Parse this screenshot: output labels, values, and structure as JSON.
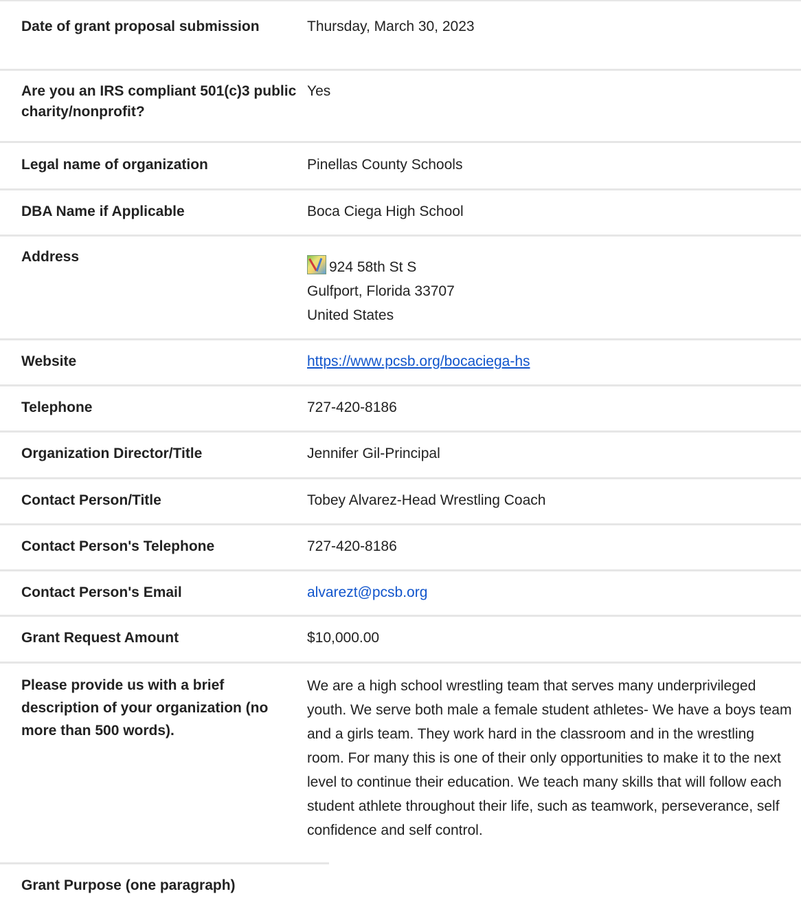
{
  "rows": [
    {
      "label": "Date of grant proposal submission",
      "value": "Thursday, March 30, 2023"
    },
    {
      "label": "Are you an IRS compliant 501(c)3 public charity/nonprofit?",
      "value": "Yes"
    },
    {
      "label": "Legal name of organization",
      "value": "Pinellas County Schools"
    },
    {
      "label": "DBA Name if Applicable",
      "value": "Boca Ciega High School"
    },
    {
      "label": "Address",
      "value": [
        "924 58th St S",
        "Gulfport, Florida 33707",
        "United States"
      ],
      "icon": "map-icon"
    },
    {
      "label": "Website",
      "value": "https://www.pcsb.org/bocaciega-hs"
    },
    {
      "label": "Telephone",
      "value": "727-420-8186"
    },
    {
      "label": "Organization Director/Title",
      "value": "Jennifer Gil-Principal"
    },
    {
      "label": "Contact Person/Title",
      "value": "Tobey Alvarez-Head Wrestling Coach"
    },
    {
      "label": "Contact Person's Telephone",
      "value": "727-420-8186"
    },
    {
      "label": "Contact Person's Email",
      "value": "alvarezt@pcsb.org"
    },
    {
      "label": "Grant Request Amount",
      "value": "$10,000.00"
    },
    {
      "label": "Please provide us with a brief description of your organization (no more than 500 words).",
      "value": "We are a high school wrestling team that serves many underprivileged youth. We serve both male a female student athletes- We have a boys team and a girls team. They work hard in the classroom and in the wrestling room. For many this is one of their only opportunities to make it to the next level to continue their education. We teach many skills that will follow each student athlete throughout their life, such as teamwork, perseverance, self confidence and self control."
    },
    {
      "label": "Grant Purpose (one paragraph)",
      "value": ""
    }
  ],
  "colors": {
    "link": "#1155cc",
    "border": "#e6e6e6",
    "text": "#222222"
  }
}
